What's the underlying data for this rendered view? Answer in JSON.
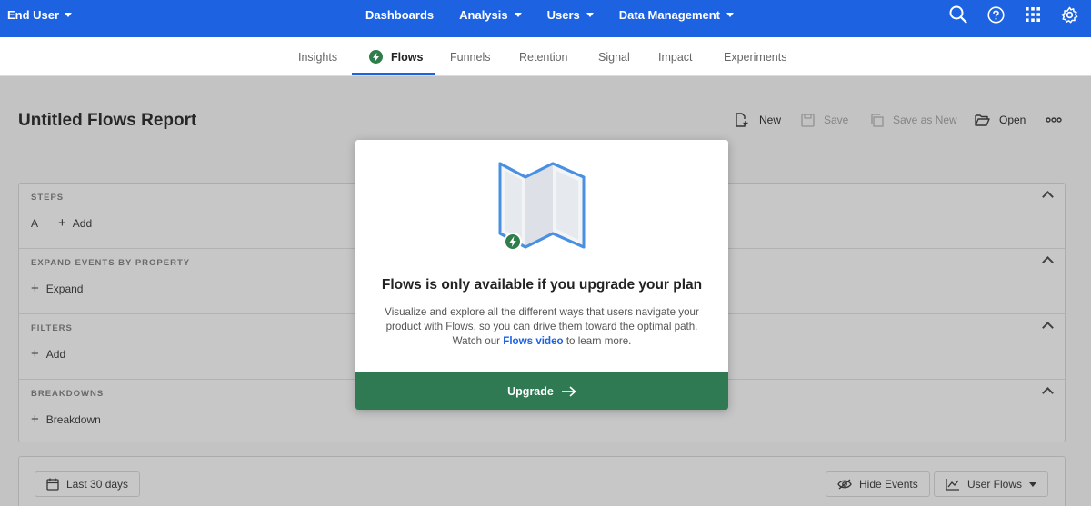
{
  "topnav": {
    "user_label": "End User",
    "items": [
      {
        "label": "Dashboards",
        "has_caret": false
      },
      {
        "label": "Analysis",
        "has_caret": true
      },
      {
        "label": "Users",
        "has_caret": true
      },
      {
        "label": "Data Management",
        "has_caret": true
      }
    ],
    "icons": [
      "search-icon",
      "help-icon",
      "apps-grid-icon",
      "gear-icon"
    ],
    "color": "#1d62e0"
  },
  "subtabs": {
    "items": [
      "Insights",
      "Flows",
      "Funnels",
      "Retention",
      "Signal",
      "Impact",
      "Experiments"
    ],
    "active": "Flows"
  },
  "report": {
    "title": "Untitled Flows Report",
    "actions": {
      "new_label": "New",
      "save_label": "Save",
      "save_as_new_label": "Save as New",
      "open_label": "Open"
    }
  },
  "panel": {
    "steps": {
      "label": "STEPS",
      "marker": "A",
      "add_label": "Add"
    },
    "expand": {
      "label": "EXPAND EVENTS BY PROPERTY",
      "add_label": "Expand"
    },
    "filters": {
      "label": "FILTERS",
      "add_label": "Add"
    },
    "breakdowns": {
      "label": "BREAKDOWNS",
      "add_label": "Breakdown"
    }
  },
  "bottombar": {
    "date_label": "Last 30 days",
    "hide_events_label": "Hide Events",
    "view_label": "User Flows"
  },
  "modal": {
    "title": "Flows is only available if you upgrade your plan",
    "body_before": "Visualize and explore all the different ways that users navigate your product with Flows, so you can drive them toward the optimal path. Watch our ",
    "body_link": "Flows video",
    "body_after": " to learn more.",
    "button_label": "Upgrade",
    "button_color": "#2f7a52"
  }
}
